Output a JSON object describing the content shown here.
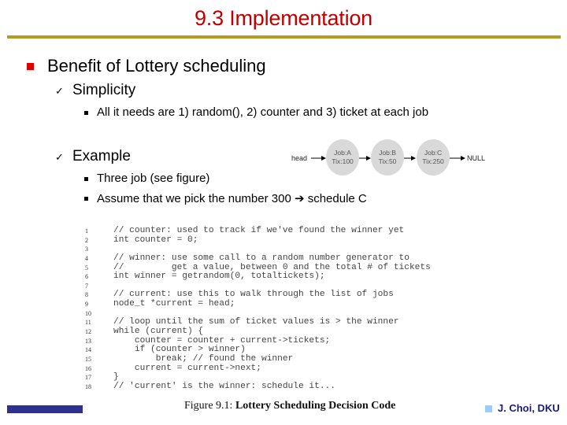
{
  "slide": {
    "title": "9.3 Implementation",
    "accent_color": "#c00000",
    "rule_color": "#b79a1f"
  },
  "bullets": {
    "level1": "Benefit of Lottery scheduling",
    "simplicity": {
      "label": "Simplicity",
      "sub": "All it needs are 1) random(), 2) counter and 3) ticket at each job"
    },
    "example": {
      "label": "Example",
      "sub1": "Three job (see figure)",
      "sub2": "Assume that we pick the number 300 ➔ schedule C"
    }
  },
  "diagram": {
    "head_label": "head",
    "null_label": "NULL",
    "jobs": [
      {
        "job": "Job:A",
        "tix": "Tix:100"
      },
      {
        "job": "Job:B",
        "tix": "Tix:50"
      },
      {
        "job": "Job:C",
        "tix": "Tix:250"
      }
    ]
  },
  "code": {
    "lines": [
      {
        "n": "1",
        "text": "// counter: used to track if we've found the winner yet"
      },
      {
        "n": "2",
        "text": "int counter = 0;"
      },
      {
        "n": "3",
        "text": ""
      },
      {
        "n": "4",
        "text": "// winner: use some call to a random number generator to"
      },
      {
        "n": "5",
        "text": "//         get a value, between 0 and the total # of tickets"
      },
      {
        "n": "6",
        "text": "int winner = getrandom(0, totaltickets);"
      },
      {
        "n": "7",
        "text": ""
      },
      {
        "n": "8",
        "text": "// current: use this to walk through the list of jobs"
      },
      {
        "n": "9",
        "text": "node_t *current = head;"
      },
      {
        "n": "10",
        "text": ""
      },
      {
        "n": "11",
        "text": "// loop until the sum of ticket values is > the winner"
      },
      {
        "n": "12",
        "text": "while (current) {"
      },
      {
        "n": "13",
        "text": "    counter = counter + current->tickets;"
      },
      {
        "n": "14",
        "text": "    if (counter > winner)"
      },
      {
        "n": "15",
        "text": "        break; // found the winner"
      },
      {
        "n": "16",
        "text": "    current = current->next;"
      },
      {
        "n": "17",
        "text": "}"
      },
      {
        "n": "18",
        "text": "// 'current' is the winner: schedule it..."
      }
    ],
    "caption_prefix": "Figure 9.1:",
    "caption_title": "Lottery Scheduling Decision Code"
  },
  "footer": {
    "author": "J. Choi, DKU"
  }
}
